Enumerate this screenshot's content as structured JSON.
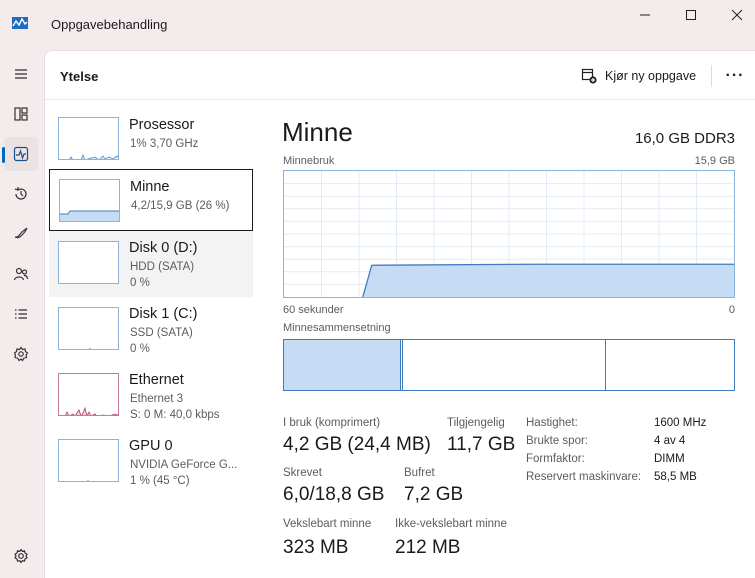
{
  "window": {
    "title": "Oppgavebehandling",
    "minimize_glyph": "—",
    "maximize_glyph": "☐",
    "close_glyph": "✕"
  },
  "nav_icons": [
    "hamburger-icon",
    "processes-icon",
    "performance-icon",
    "app-history-icon",
    "startup-apps-icon",
    "users-icon",
    "details-icon",
    "services-icon",
    "settings-icon"
  ],
  "header": {
    "title": "Ytelse",
    "run_task": "Kjør ny oppgave",
    "more": "···"
  },
  "resources": [
    {
      "name": "Prosessor",
      "sub1": "1% 3,70 GHz",
      "sub2": ""
    },
    {
      "name": "Minne",
      "sub1": "4,2/15,9 GB (26 %)",
      "sub2": ""
    },
    {
      "name": "Disk 0 (D:)",
      "sub1": "HDD (SATA)",
      "sub2": "0 %"
    },
    {
      "name": "Disk 1 (C:)",
      "sub1": "SSD (SATA)",
      "sub2": "0 %"
    },
    {
      "name": "Ethernet",
      "sub1": "Ethernet 3",
      "sub2": "S: 0 M: 40,0 kbps"
    },
    {
      "name": "GPU 0",
      "sub1": "NVIDIA GeForce G...",
      "sub2": "1 % (45 °C)"
    }
  ],
  "detail": {
    "title": "Minne",
    "spec": "16,0 GB DDR3",
    "usage_label": "Minnebruk",
    "usage_max": "15,9 GB",
    "time_left": "60 sekunder",
    "time_right": "0",
    "composition_label": "Minnesammensetning",
    "usage_fraction": 0.26,
    "composition_fractions": [
      0.26,
      0.005,
      0.45,
      0.285
    ]
  },
  "stats": {
    "in_use_label": "I bruk (komprimert)",
    "in_use_value": "4,2 GB (24,4 MB)",
    "available_label": "Tilgjengelig",
    "available_value": "11,7 GB",
    "committed_label": "Skrevet",
    "committed_value": "6,0/18,8 GB",
    "cached_label": "Bufret",
    "cached_value": "7,2 GB",
    "paged_label": "Vekslebart minne",
    "paged_value": "323 MB",
    "nonpaged_label": "Ikke-vekslebart minne",
    "nonpaged_value": "212 MB"
  },
  "properties": [
    {
      "key": "Hastighet:",
      "value": "1600 MHz"
    },
    {
      "key": "Brukte spor:",
      "value": "4 av 4"
    },
    {
      "key": "Formfaktor:",
      "value": "DIMM"
    },
    {
      "key": "Reservert maskinvare:",
      "value": "58,5 MB"
    }
  ],
  "colors": {
    "accent": "#0067c0",
    "memory_line": "#3f7cbf",
    "memory_fill": "#c6dcf5",
    "ethernet": "#b23a6e"
  }
}
